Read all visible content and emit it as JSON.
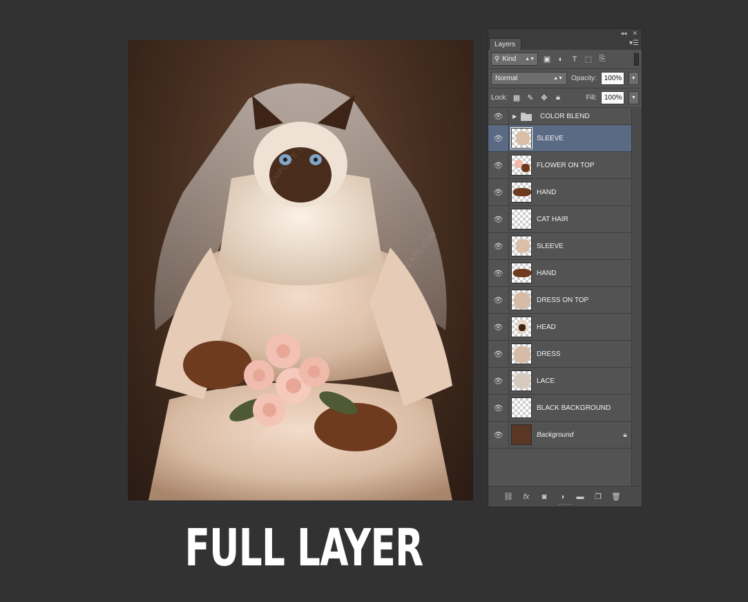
{
  "caption": "FULL LAYER",
  "watermark_text": "PETPORTRAITEMPLATE.COM",
  "panel": {
    "tab_label": "Layers",
    "collapse_glyph": "◂◂",
    "close_glyph": "✕",
    "filter": {
      "kind_label": "Kind",
      "icons": [
        "image-filter-icon",
        "adjustment-filter-icon",
        "type-filter-icon",
        "shape-filter-icon",
        "smart-object-filter-icon"
      ]
    },
    "blend_mode": "Normal",
    "opacity_label": "Opacity:",
    "opacity_value": "100%",
    "lock_label": "Lock:",
    "fill_label": "Fill:",
    "fill_value": "100%",
    "group": {
      "name": "COLOR BLEND"
    },
    "layers": [
      {
        "name": "SLEEVE",
        "selected": true,
        "thumb": "sleeve"
      },
      {
        "name": "FLOWER ON TOP",
        "selected": false,
        "thumb": "flower"
      },
      {
        "name": "HAND",
        "selected": false,
        "thumb": "hand"
      },
      {
        "name": "CAT HAIR",
        "selected": false,
        "thumb": "empty"
      },
      {
        "name": "SLEEVE",
        "selected": false,
        "thumb": "sleeve"
      },
      {
        "name": "HAND",
        "selected": false,
        "thumb": "hand"
      },
      {
        "name": "DRESS ON TOP",
        "selected": false,
        "thumb": "dress"
      },
      {
        "name": "HEAD",
        "selected": false,
        "thumb": "head"
      },
      {
        "name": "DRESS",
        "selected": false,
        "thumb": "dress"
      },
      {
        "name": "LACE",
        "selected": false,
        "thumb": "lace"
      },
      {
        "name": "BLACK BACKGROUND",
        "selected": false,
        "thumb": "empty"
      },
      {
        "name": "Background",
        "selected": false,
        "thumb": "background",
        "italic": true,
        "locked": true
      }
    ]
  },
  "colors": {
    "selected_row": "#5b6a84",
    "panel_bg": "#535353",
    "app_bg": "#323232"
  }
}
